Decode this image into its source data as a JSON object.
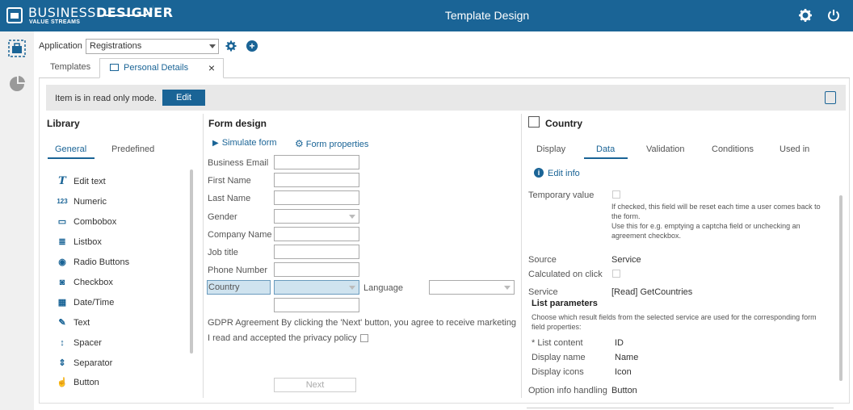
{
  "brand": {
    "name_light": "BUSINESS",
    "name_bold": "DESIGNER",
    "tagline": "VALUE STREAMS"
  },
  "header": {
    "title": "Template Design",
    "settings_icon": "gear-icon",
    "power_icon": "power-icon"
  },
  "sidebar": {
    "items": [
      {
        "icon": "toolbox-icon"
      },
      {
        "icon": "pie-chart-icon"
      }
    ]
  },
  "appbar": {
    "label": "Application",
    "selected": "Registrations"
  },
  "tabs": [
    {
      "label": "Templates"
    },
    {
      "label": "Personal Details",
      "close": "×"
    }
  ],
  "readonly": {
    "message": "Item is in read only mode.",
    "edit_label": "Edit"
  },
  "library": {
    "title": "Library",
    "tabs": [
      "General",
      "Predefined"
    ],
    "items": [
      {
        "label": "Edit text",
        "glyph": "T"
      },
      {
        "label": "Numeric",
        "glyph": "123"
      },
      {
        "label": "Combobox",
        "glyph": "▭"
      },
      {
        "label": "Listbox",
        "glyph": "≣"
      },
      {
        "label": "Radio Buttons",
        "glyph": "◉"
      },
      {
        "label": "Checkbox",
        "glyph": "◙"
      },
      {
        "label": "Date/Time",
        "glyph": "▦"
      },
      {
        "label": "Text",
        "glyph": "✎"
      },
      {
        "label": "Spacer",
        "glyph": "↕"
      },
      {
        "label": "Separator",
        "glyph": "⇕"
      },
      {
        "label": "Button",
        "glyph": "☝"
      }
    ]
  },
  "form": {
    "title": "Form design",
    "simulate": "Simulate form",
    "properties": "Form properties",
    "fields": [
      "Business Email",
      "First Name",
      "Last Name",
      "Gender",
      "Company Name",
      "Job title",
      "Phone Number",
      "Country"
    ],
    "language_label": "Language",
    "gdpr_text": "GDPR Agreement By clicking the 'Next' button, you agree to receive marketing c",
    "privacy_text": "I read and accepted the privacy policy",
    "next_label": "Next"
  },
  "properties": {
    "title": "Country",
    "tabs": [
      "Display",
      "Data",
      "Validation",
      "Conditions",
      "Used in"
    ],
    "edit_info": "Edit info",
    "temporary_label": "Temporary value",
    "temporary_note": "If checked, this field will be reset each time a user comes back to the form.\nUse this for e.g. emptying a captcha field or unchecking an agreement checkbox.",
    "source_label": "Source",
    "source_value": "Service",
    "calculated_label": "Calculated on click",
    "service_label": "Service",
    "service_value": "[Read] GetCountries",
    "list_params_title": "List parameters",
    "list_params_desc": "Choose which result fields from the selected service are used for the corresponding form field properties:",
    "list_params": [
      {
        "label": "* List content",
        "value": "ID"
      },
      {
        "label": "Display name",
        "value": "Name"
      },
      {
        "label": "Display icons",
        "value": "Icon"
      }
    ],
    "option_info_label": "Option info handling",
    "option_info_value": "Button"
  }
}
